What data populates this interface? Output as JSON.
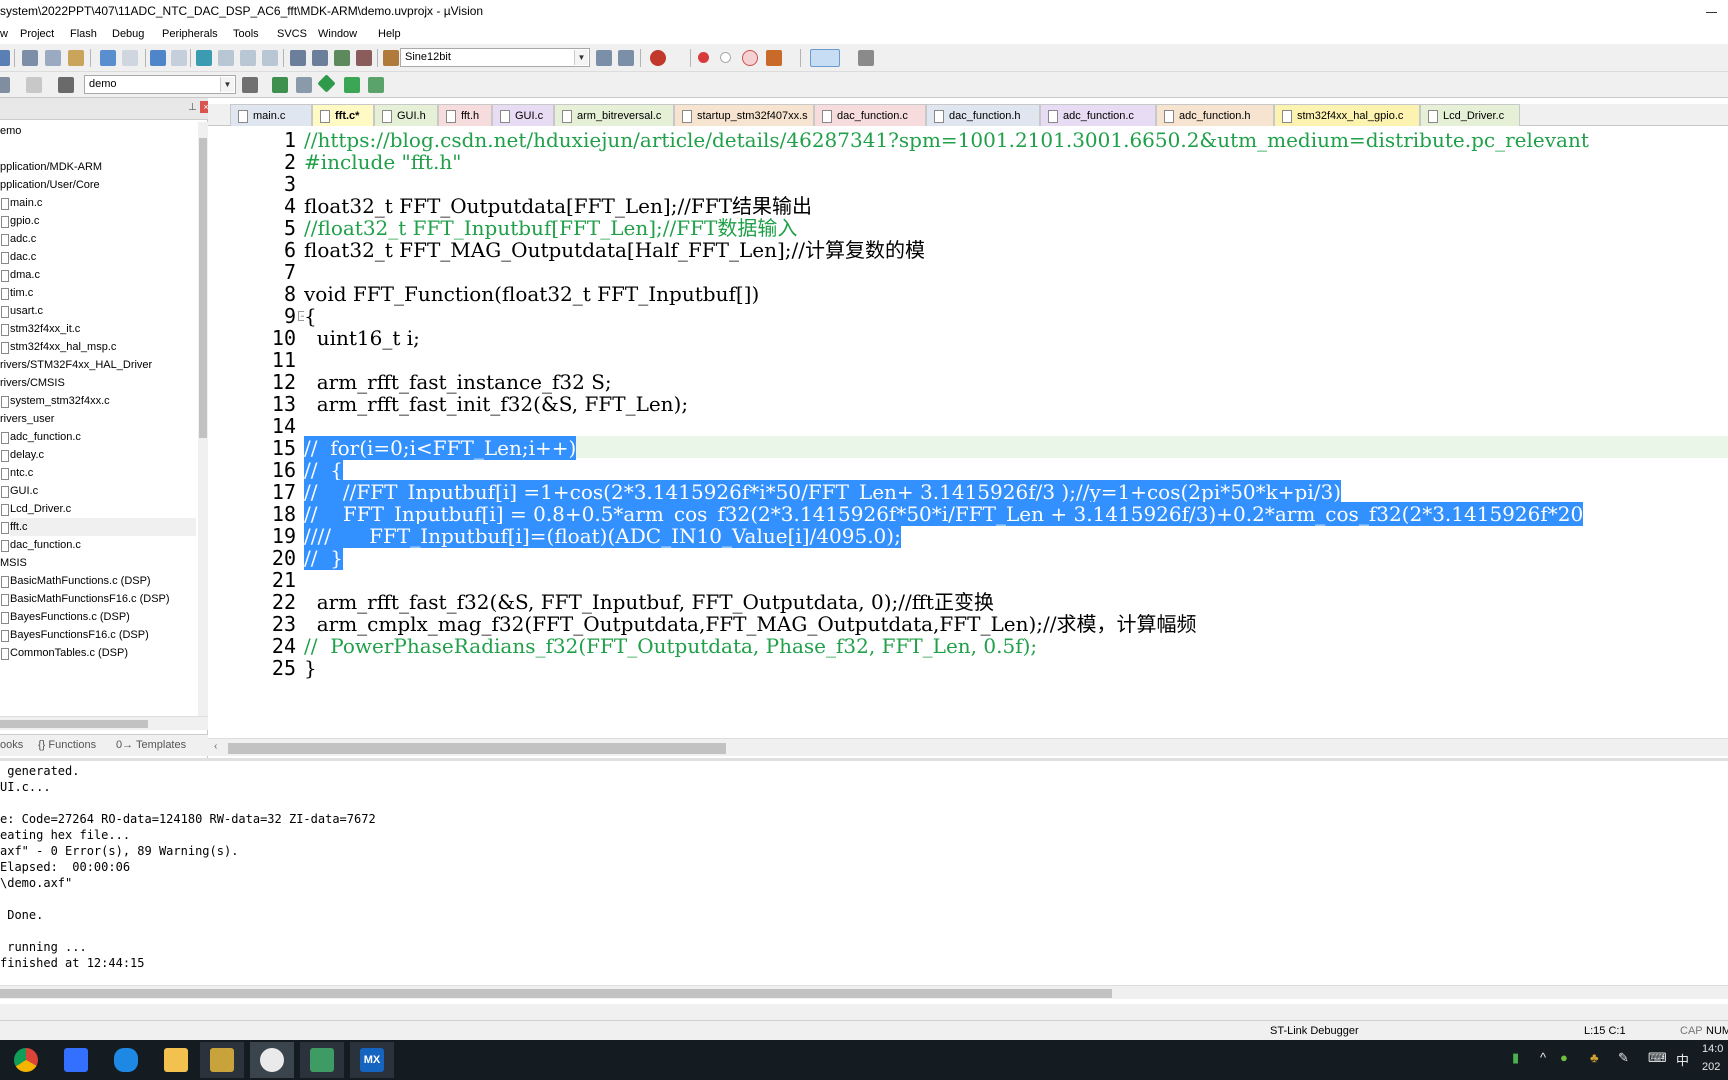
{
  "window": {
    "title": "system\\2022PPT\\407\\11ADC_NTC_DAC_DSP_AC6_fft\\MDK-ARM\\demo.uvprojx - µVision"
  },
  "menu": [
    "w",
    "Project",
    "Flash",
    "Debug",
    "Peripherals",
    "Tools",
    "SVCS",
    "Window",
    "Help"
  ],
  "toolbar": {
    "find_combo": "Sine12bit",
    "target_combo": "demo"
  },
  "project": {
    "items": [
      {
        "label": "emo",
        "type": "group"
      },
      {
        "label": "pplication/MDK-ARM",
        "type": "group"
      },
      {
        "label": "pplication/User/Core",
        "type": "group"
      },
      {
        "label": "main.c",
        "type": "file"
      },
      {
        "label": "gpio.c",
        "type": "file"
      },
      {
        "label": "adc.c",
        "type": "file"
      },
      {
        "label": "dac.c",
        "type": "file"
      },
      {
        "label": "dma.c",
        "type": "file"
      },
      {
        "label": "tim.c",
        "type": "file"
      },
      {
        "label": "usart.c",
        "type": "file"
      },
      {
        "label": "stm32f4xx_it.c",
        "type": "file"
      },
      {
        "label": "stm32f4xx_hal_msp.c",
        "type": "file"
      },
      {
        "label": "rivers/STM32F4xx_HAL_Driver",
        "type": "group"
      },
      {
        "label": "rivers/CMSIS",
        "type": "group"
      },
      {
        "label": "system_stm32f4xx.c",
        "type": "file"
      },
      {
        "label": "rivers_user",
        "type": "group"
      },
      {
        "label": "adc_function.c",
        "type": "file"
      },
      {
        "label": "delay.c",
        "type": "file"
      },
      {
        "label": "ntc.c",
        "type": "file"
      },
      {
        "label": "GUI.c",
        "type": "file"
      },
      {
        "label": "Lcd_Driver.c",
        "type": "file"
      },
      {
        "label": "fft.c",
        "type": "file"
      },
      {
        "label": "dac_function.c",
        "type": "file"
      },
      {
        "label": "MSIS",
        "type": "group"
      },
      {
        "label": "BasicMathFunctions.c (DSP)",
        "type": "file"
      },
      {
        "label": "BasicMathFunctionsF16.c (DSP)",
        "type": "file"
      },
      {
        "label": "BayesFunctions.c (DSP)",
        "type": "file"
      },
      {
        "label": "BayesFunctionsF16.c (DSP)",
        "type": "file"
      },
      {
        "label": "CommonTables.c (DSP)",
        "type": "file"
      }
    ],
    "bottom_tabs": [
      "ooks",
      "{} Functions",
      "0→ Templates"
    ]
  },
  "tabs": [
    {
      "label": "main.c"
    },
    {
      "label": "fft.c*",
      "active": true
    },
    {
      "label": "GUI.h"
    },
    {
      "label": "fft.h"
    },
    {
      "label": "GUI.c"
    },
    {
      "label": "arm_bitreversal.c"
    },
    {
      "label": "startup_stm32f407xx.s"
    },
    {
      "label": "dac_function.c"
    },
    {
      "label": "dac_function.h"
    },
    {
      "label": "adc_function.c"
    },
    {
      "label": "adc_function.h"
    },
    {
      "label": "stm32f4xx_hal_gpio.c"
    },
    {
      "label": "Lcd_Driver.c"
    }
  ],
  "code": {
    "lines": [
      {
        "n": "1",
        "text": "//https://blog.csdn.net/hduxiejun/article/details/46287341?spm=1001.2101.3001.6650.2&utm_medium=distribute.pc_relevant",
        "style": "cm"
      },
      {
        "n": "2",
        "text": "#include \"fft.h\"",
        "style": "cm"
      },
      {
        "n": "3",
        "text": "",
        "style": ""
      },
      {
        "n": "4",
        "text": "float32_t FFT_Outputdata[FFT_Len];//FFT结果输出",
        "style": ""
      },
      {
        "n": "5",
        "text": "//float32_t FFT_Inputbuf[FFT_Len];//FFT数据输入",
        "style": "cm"
      },
      {
        "n": "6",
        "text": "float32_t FFT_MAG_Outputdata[Half_FFT_Len];//计算复数的模",
        "style": ""
      },
      {
        "n": "7",
        "text": "",
        "style": ""
      },
      {
        "n": "8",
        "text": "void FFT_Function(float32_t FFT_Inputbuf[])",
        "style": ""
      },
      {
        "n": "9",
        "text": "{",
        "style": ""
      },
      {
        "n": "10",
        "text": "  uint16_t i;",
        "style": ""
      },
      {
        "n": "11",
        "text": "",
        "style": ""
      },
      {
        "n": "12",
        "text": "  arm_rfft_fast_instance_f32 S;",
        "style": ""
      },
      {
        "n": "13",
        "text": "  arm_rfft_fast_init_f32(&S, FFT_Len);",
        "style": ""
      },
      {
        "n": "14",
        "text": "",
        "style": ""
      },
      {
        "n": "15",
        "text": "//  for(i=0;i<FFT_Len;i++)",
        "style": "sel"
      },
      {
        "n": "16",
        "text": "//  {",
        "style": "sel"
      },
      {
        "n": "17",
        "text": "//    //FFT_Inputbuf[i] =1+cos(2*3.1415926f*i*50/FFT_Len+ 3.1415926f/3 );//y=1+cos(2pi*50*k+pi/3)",
        "style": "sel"
      },
      {
        "n": "18",
        "text": "//    FFT_Inputbuf[i] = 0.8+0.5*arm_cos_f32(2*3.1415926f*50*i/FFT_Len + 3.1415926f/3)+0.2*arm_cos_f32(2*3.1415926f*20",
        "style": "sel"
      },
      {
        "n": "19",
        "text": "////      FFT_Inputbuf[i]=(float)(ADC_IN10_Value[i]/4095.0);",
        "style": "sel"
      },
      {
        "n": "20",
        "text": "//  }",
        "style": "sel"
      },
      {
        "n": "21",
        "text": "",
        "style": ""
      },
      {
        "n": "22",
        "text": "  arm_rfft_fast_f32(&S, FFT_Inputbuf, FFT_Outputdata, 0);//fft正变换",
        "style": ""
      },
      {
        "n": "23",
        "text": "  arm_cmplx_mag_f32(FFT_Outputdata,FFT_MAG_Outputdata,FFT_Len);//求模，计算幅频",
        "style": ""
      },
      {
        "n": "24",
        "text": "//  PowerPhaseRadians_f32(FFT_Outputdata, Phase_f32, FFT_Len, 0.5f);",
        "style": "cm"
      },
      {
        "n": "25",
        "text": "}",
        "style": ""
      }
    ]
  },
  "output": {
    "lines": [
      " generated.",
      "UI.c...",
      "",
      "e: Code=27264 RO-data=124180 RW-data=32 ZI-data=7672",
      "eating hex file...",
      "axf\" - 0 Error(s), 89 Warning(s).",
      "Elapsed:  00:00:06",
      "\\demo.axf\"",
      "",
      " Done.",
      "",
      " running ...",
      "finished at 12:44:15"
    ]
  },
  "status": {
    "debugger": "ST-Link Debugger",
    "position": "L:15 C:1",
    "caps": "CAP",
    "num": "NUM"
  },
  "taskbar": {
    "apps": [
      "chrome-icon",
      "feishu-icon",
      "onedrive-icon",
      "explorer-icon",
      "powerpoint-icon",
      "keil-icon",
      "vscode-icon",
      "stm32cubemx-icon"
    ],
    "ime": "中",
    "clock": "14:0",
    "date": "202"
  }
}
